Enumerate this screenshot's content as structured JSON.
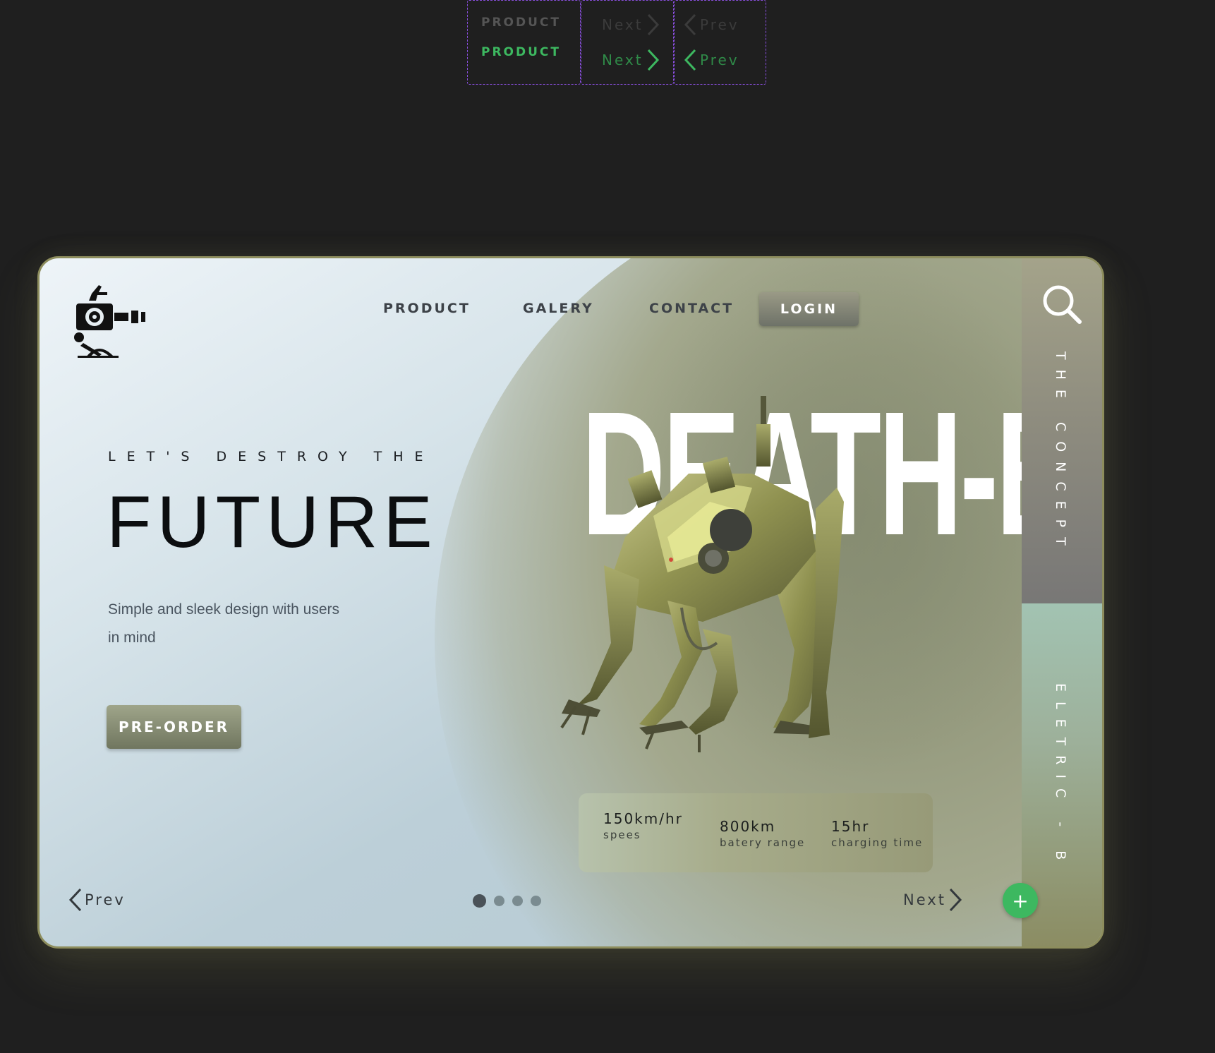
{
  "component_sheet": {
    "product_default": "PRODUCT",
    "product_active": "PRODUCT",
    "next_default": "Next",
    "next_active": "Next",
    "prev_default": "Prev",
    "prev_active": "Prev"
  },
  "nav": {
    "items": [
      {
        "label": "PRODUCT"
      },
      {
        "label": "GALERY"
      },
      {
        "label": "CONTACT"
      }
    ],
    "login_label": "LOGIN"
  },
  "hero": {
    "eyebrow": "LET'S DESTROY THE",
    "headline": "FUTURE",
    "lede": "Simple and sleek design with users in mind",
    "cta_label": "PRE-ORDER",
    "product_name": "DEATH-B"
  },
  "stats": [
    {
      "value": "150km/hr",
      "label": "spees"
    },
    {
      "value": "800km",
      "label": "batery range"
    },
    {
      "value": "15hr",
      "label": "charging time"
    }
  ],
  "pager": {
    "prev_label": "Prev",
    "next_label": "Next",
    "total_dots": 4,
    "active_index": 0
  },
  "fab_label": "+",
  "side_panel": {
    "top_text": "THE CONCEPT",
    "bottom_text": "ELETRIC - B"
  },
  "colors": {
    "accent_green": "#3db860",
    "olive": "#8d8d5d",
    "background": "#1f1f1f"
  }
}
